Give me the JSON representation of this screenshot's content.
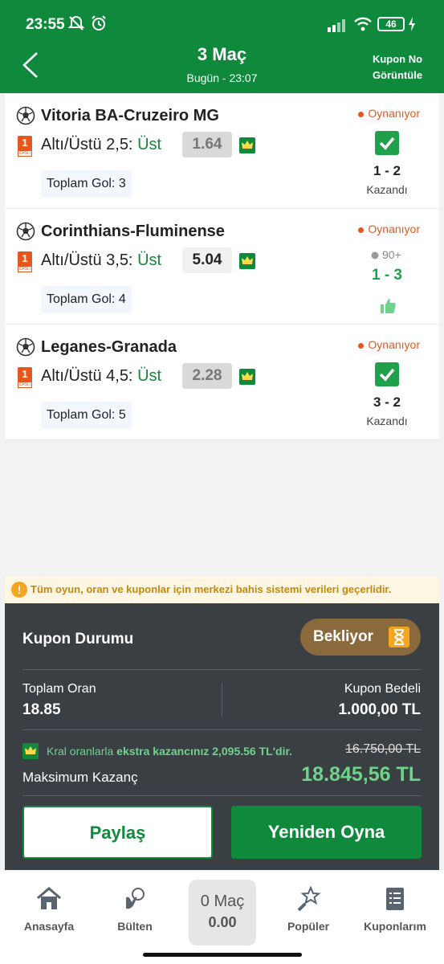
{
  "status_bar": {
    "time": "23:55",
    "battery": "46"
  },
  "header": {
    "title": "3 Maç",
    "subtitle": "Bugün - 23:07",
    "coupon_no_label": "Kupon No Görüntüle"
  },
  "matches": [
    {
      "teams": "Vitoria BA-Cruzeiro MG",
      "live_num": "1",
      "live_label": "CANLI",
      "market": "Altı/Üstü 2,5:",
      "selection": "Üst",
      "odd": "1.64",
      "goals": "Toplam Gol: 3",
      "state": "Oynanıyor",
      "score": "1 - 2",
      "result": "Kazandı"
    },
    {
      "teams": "Corinthians-Fluminense",
      "live_num": "1",
      "live_label": "CANLI",
      "market": "Altı/Üstü 3,5:",
      "selection": "Üst",
      "odd": "5.04",
      "goals": "Toplam Gol: 4",
      "state": "Oynanıyor",
      "minute": "90+",
      "score": "1 - 3"
    },
    {
      "teams": "Leganes-Granada",
      "live_num": "1",
      "live_label": "CANLI",
      "market": "Altı/Üstü 4,5:",
      "selection": "Üst",
      "odd": "2.28",
      "goals": "Toplam Gol: 5",
      "state": "Oynanıyor",
      "score": "3 - 2",
      "result": "Kazandı"
    }
  ],
  "notice": "Tüm oyun, oran ve kuponlar için merkezi bahis sistemi verileri geçerlidir.",
  "coupon": {
    "status_label": "Kupon Durumu",
    "status_badge": "Bekliyor",
    "total_odds_label": "Toplam Oran",
    "total_odds": "18.85",
    "stake_label": "Kupon Bedeli",
    "stake": "1.000,00 TL",
    "kral_prefix": "Kral oranlarla",
    "kral_bold": "ekstra kazancınız 2,095.56 TL'dir.",
    "old_max": "16.750,00 TL",
    "max_label": "Maksimum Kazanç",
    "max_value": "18.845,56 TL",
    "share_label": "Paylaş",
    "replay_label": "Yeniden Oyna"
  },
  "nav": {
    "home": "Anasayfa",
    "bulletin": "Bülten",
    "slip_count": "0 Maç",
    "slip_odds": "0.00",
    "popular": "Popüler",
    "coupons": "Kuponlarım"
  },
  "colors": {
    "brand_green": "#0f8a3c",
    "live_orange": "#e8561c",
    "panel_dark": "#3a3f44",
    "win_green": "#6fd38a"
  }
}
